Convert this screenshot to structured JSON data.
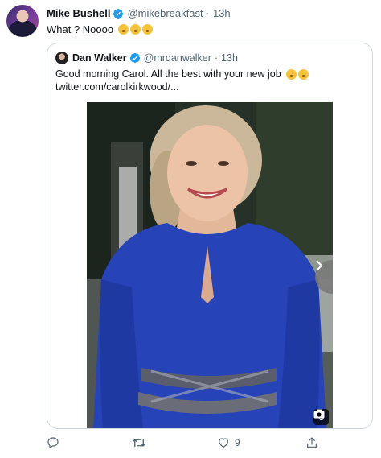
{
  "tweet": {
    "author_name": "Mike Bushell",
    "author_handle": "@mikebreakfast",
    "separator": "·",
    "time": "13h",
    "text": "What ? Noooo",
    "emoji_icons": [
      "astonished-face-emoji",
      "astonished-face-emoji",
      "astonished-face-emoji"
    ]
  },
  "quoted": {
    "author_name": "Dan Walker",
    "author_handle": "@mrdanwalker",
    "separator": "·",
    "time": "13h",
    "text_line1": "Good morning Carol. All the best with your new job",
    "emoji_icons": [
      "tears-of-joy-emoji",
      "winking-face-emoji"
    ],
    "text_line2": "twitter.com/carolkirkwood/...",
    "media": {
      "photo_count": "3",
      "next_icon": "chevron-right-icon",
      "camera_icon": "camera-icon"
    }
  },
  "actions": {
    "reply_icon": "reply-icon",
    "retweet_icon": "retweet-icon",
    "like_icon": "heart-icon",
    "like_count": "9",
    "share_icon": "share-icon"
  },
  "colors": {
    "verified": "#1d9bf0",
    "text": "#0f1419",
    "secondary_text": "#536471",
    "border": "#cfd9de",
    "dress": "#2643b8"
  }
}
